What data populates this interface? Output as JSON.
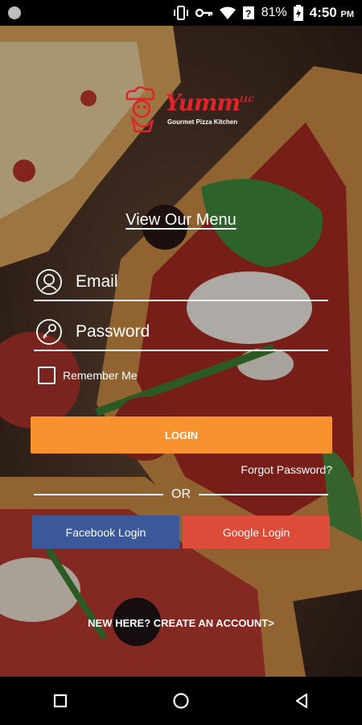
{
  "status_bar": {
    "battery": "81%",
    "time": "4:50",
    "ampm": "PM",
    "icons": [
      "notification-dot-icon",
      "vibrate-icon",
      "key-icon",
      "wifi-icon",
      "signal-icon",
      "battery-icon"
    ]
  },
  "logo": {
    "name": "Yumm",
    "superscript": "LLC",
    "tagline": "Gourmet Pizza Kitchen"
  },
  "menu_link": "View Our Menu",
  "form": {
    "email_placeholder": "Email",
    "password_placeholder": "Password",
    "remember_label": "Remember Me",
    "login_label": "LOGIN",
    "forgot_label": "Forgot Password?",
    "or_label": "OR"
  },
  "social": {
    "facebook_label": "Facebook Login",
    "google_label": "Google Login"
  },
  "create_account": "NEW HERE? CREATE AN ACCOUNT>",
  "colors": {
    "accent": "#f7922f",
    "facebook": "#3b5998",
    "google": "#dd4b39",
    "brand": "#e0242b"
  },
  "nav": [
    "recent-apps-icon",
    "home-icon",
    "back-icon"
  ]
}
